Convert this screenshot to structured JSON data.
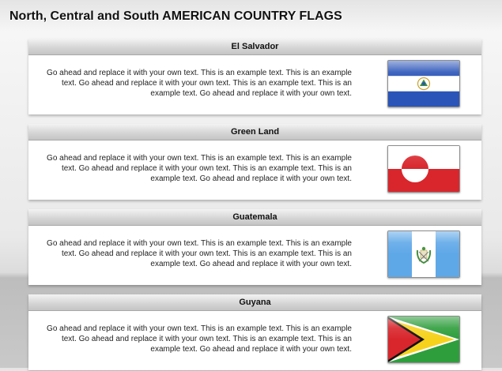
{
  "page": {
    "title": "North, Central and South AMERICAN COUNTRY FLAGS"
  },
  "panels": [
    {
      "country": "El Salvador",
      "text": "Go ahead and replace it with your own text. This is an example text. This is an example text. Go ahead and replace it with your own text. This is an example text. This is an example text. Go ahead and replace it with your own text.",
      "flag_icon": "el-salvador-flag-icon",
      "colors": [
        "#2a54b8",
        "#ffffff"
      ]
    },
    {
      "country": "Green Land",
      "text": "Go ahead and replace it with your own text. This is an example text. This is an example text. Go ahead and replace it with your own text. This is an example text. This is an example text. Go ahead and replace it with your own text.",
      "flag_icon": "greenland-flag-icon",
      "colors": [
        "#d8262c",
        "#ffffff"
      ]
    },
    {
      "country": "Guatemala",
      "text": "Go ahead and replace it with your own text. This is an example text. This is an example text. Go ahead and replace it with your own text. This is an example text. This is an example text. Go ahead and replace it with your own text.",
      "flag_icon": "guatemala-flag-icon",
      "colors": [
        "#5fa8e8",
        "#ffffff"
      ]
    },
    {
      "country": "Guyana",
      "text": "Go ahead and replace it with your own text. This is an example text. This is an example text. Go ahead and replace it with your own text. This is an example text. This is an example text. Go ahead and replace it with your own text.",
      "flag_icon": "guyana-flag-icon",
      "colors": [
        "#2e9e3c",
        "#f6d21d",
        "#d8262c",
        "#ffffff",
        "#111111"
      ]
    }
  ]
}
